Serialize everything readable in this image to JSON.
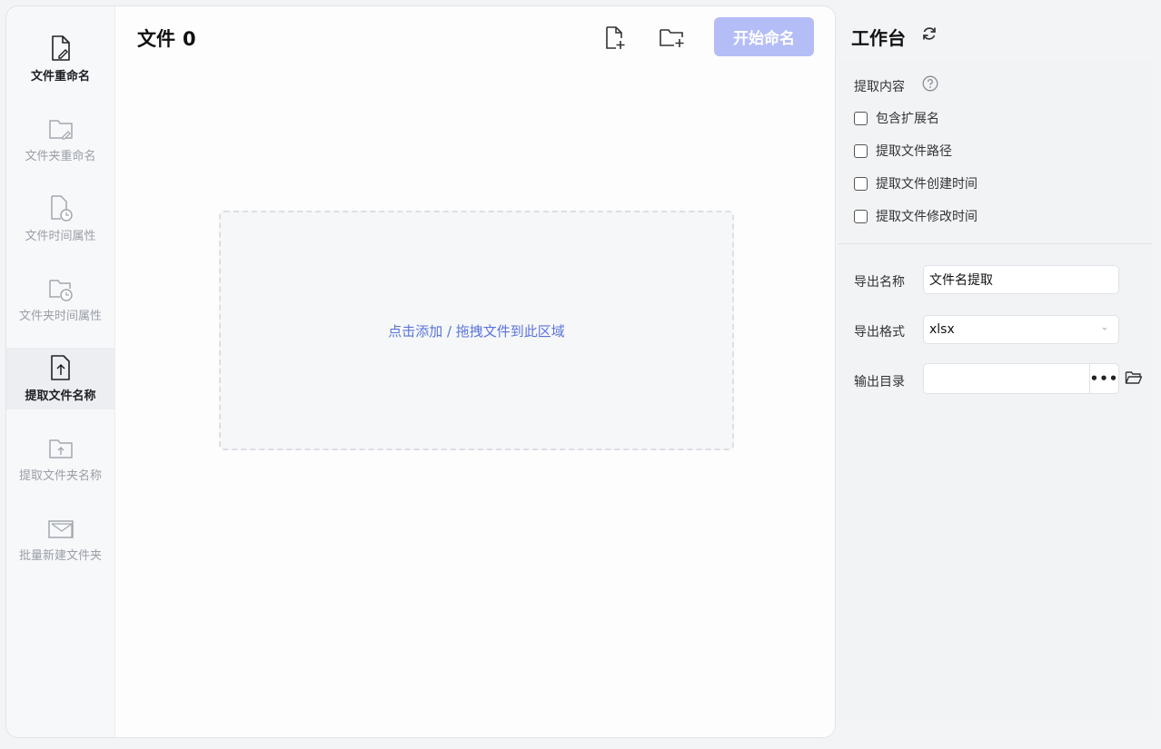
{
  "sidebar": {
    "items": [
      {
        "label": "文件重命名",
        "icon": "file-edit-icon",
        "state": "active"
      },
      {
        "label": "文件夹重命名",
        "icon": "folder-edit-icon",
        "state": "inactive"
      },
      {
        "label": "文件时间属性",
        "icon": "file-clock-icon",
        "state": "inactive"
      },
      {
        "label": "文件夹时间属性",
        "icon": "folder-clock-icon",
        "state": "inactive"
      },
      {
        "label": "提取文件名称",
        "icon": "file-upload-icon",
        "state": "selected"
      },
      {
        "label": "提取文件夹名称",
        "icon": "folder-upload-icon",
        "state": "inactive"
      },
      {
        "label": "批量新建文件夹",
        "icon": "folder-mail-icon",
        "state": "inactive"
      }
    ]
  },
  "header": {
    "files_label": "文件",
    "file_count": "0",
    "add_file_icon": "file-add-icon",
    "add_folder_icon": "folder-add-icon",
    "start_button": "开始命名"
  },
  "dropzone": {
    "text": "点击添加 / 拖拽文件到此区域"
  },
  "workbench": {
    "title": "工作台",
    "refresh_icon": "refresh-icon",
    "extract_label": "提取内容",
    "help_icon": "question-circle-icon",
    "options": [
      {
        "label": "包含扩展名",
        "checked": false
      },
      {
        "label": "提取文件路径",
        "checked": false
      },
      {
        "label": "提取文件创建时间",
        "checked": false
      },
      {
        "label": "提取文件修改时间",
        "checked": false
      }
    ],
    "export_name_label": "导出名称",
    "export_name_value": "文件名提取",
    "export_format_label": "导出格式",
    "export_format_value": "xlsx",
    "output_dir_label": "输出目录",
    "output_dir_value": "",
    "browse_label": "•••"
  },
  "colors": {
    "accent": "#5b74d9",
    "start_button_bg": "#b5bdf6",
    "panel_bg": "#f2f3f5"
  }
}
